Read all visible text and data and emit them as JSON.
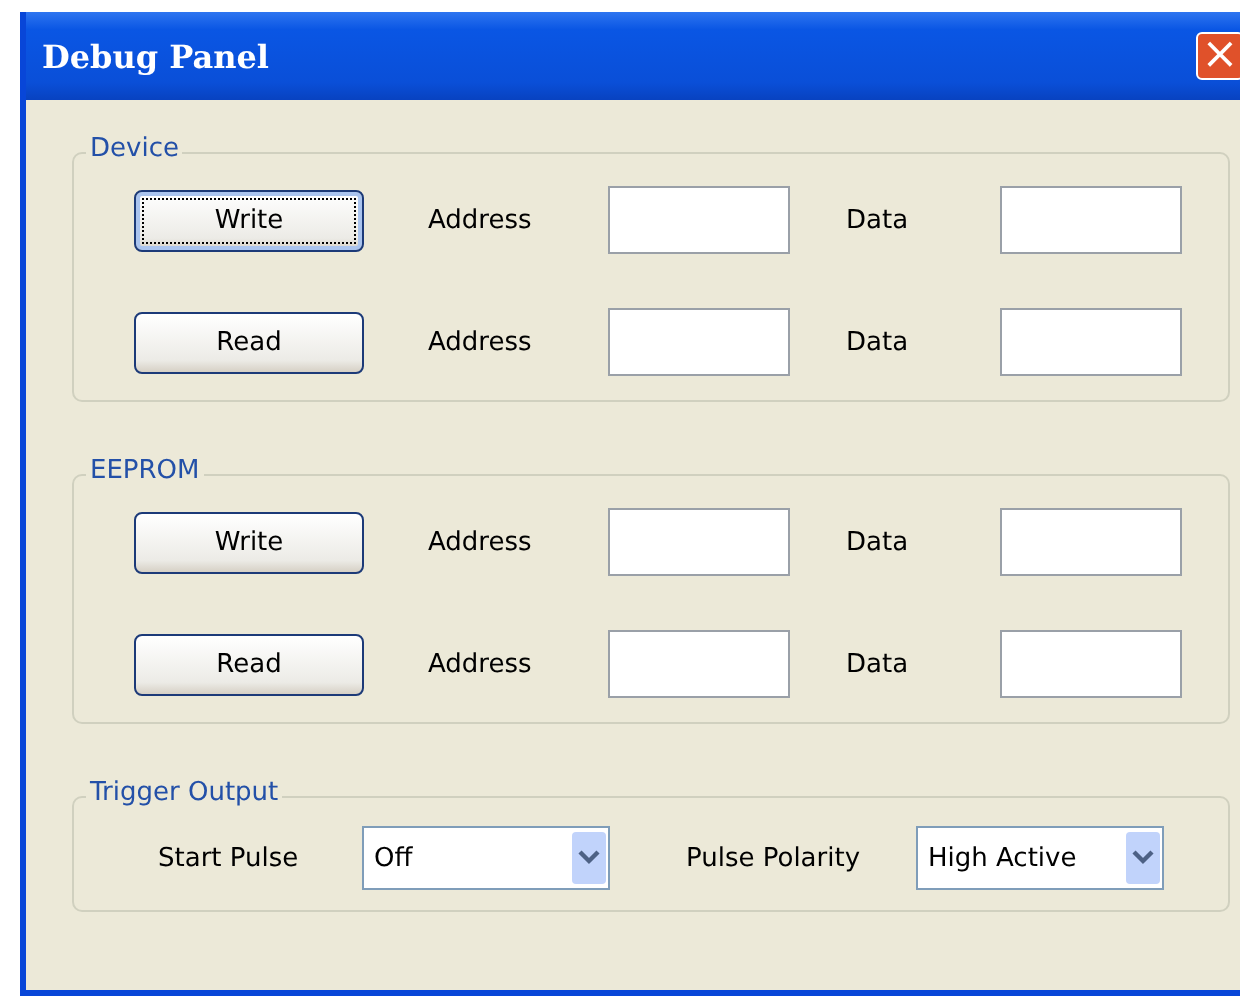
{
  "window": {
    "title": "Debug Panel",
    "close_icon": "×"
  },
  "groups": [
    {
      "title": "Device",
      "rows": [
        {
          "button": "Write",
          "focused": true,
          "address_label": "Address",
          "data_label": "Data"
        },
        {
          "button": "Read",
          "focused": false,
          "address_label": "Address",
          "data_label": "Data"
        }
      ]
    },
    {
      "title": "EEPROM",
      "rows": [
        {
          "button": "Write",
          "focused": false,
          "address_label": "Address",
          "data_label": "Data"
        },
        {
          "button": "Read",
          "focused": false,
          "address_label": "Address",
          "data_label": "Data"
        }
      ]
    }
  ],
  "trigger_output": {
    "title": "Trigger Output",
    "start_pulse": {
      "label": "Start Pulse",
      "value": "Off"
    },
    "pulse_polarity": {
      "label": "Pulse Polarity",
      "value": "High Active"
    }
  }
}
